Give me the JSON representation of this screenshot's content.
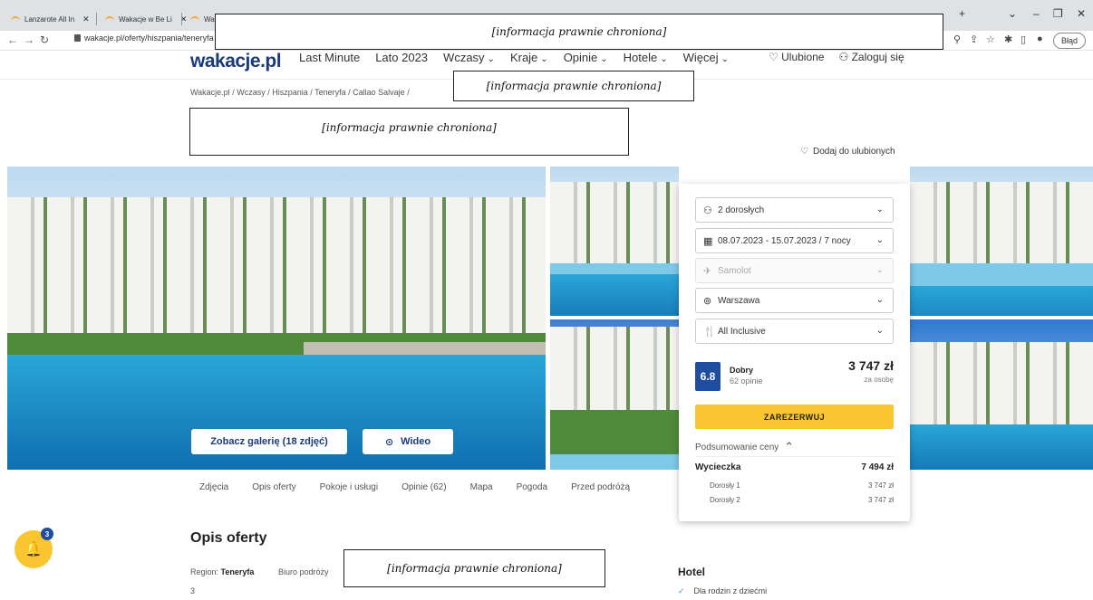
{
  "browser": {
    "tabs": [
      {
        "title": "Lanzarote All In"
      },
      {
        "title": "Wakacje w Be Li"
      },
      {
        "title": "Wak"
      }
    ],
    "url": "wakacje.pl/oferty/hiszpania/teneryfa",
    "error_badge": "Błąd",
    "new_tab": "+"
  },
  "redacted_text": "[informacja prawnie chroniona]",
  "site": {
    "logo": "wakacje.pl",
    "nav": [
      "Last Minute",
      "Lato 2023",
      "Wczasy",
      "Kraje",
      "Opinie",
      "Hotele",
      "Więcej"
    ],
    "favorites": "Ulubione",
    "login": "Zaloguj się"
  },
  "breadcrumb": [
    "Wakacje.pl",
    "Wczasy",
    "Hiszpania",
    "Teneryfa",
    "Callao Salvaje"
  ],
  "add_favorite": "Dodaj do ulubionych",
  "gallery": {
    "see_gallery": "Zobacz galerię (18 zdjęć)",
    "video": "Wideo"
  },
  "booking": {
    "travelers": "2 dorosłych",
    "dates": "08.07.2023 - 15.07.2023 / 7 nocy",
    "transport": "Samolot",
    "departure": "Warszawa",
    "board": "All Inclusive",
    "score": "6.8",
    "rating_word": "Dobry",
    "rating_count": "62 opinie",
    "price": "3 747 zł",
    "price_per": "za osobę",
    "book_label": "ZAREZERWUJ",
    "summary_title": "Podsumowanie ceny",
    "trip_label": "Wycieczka",
    "trip_total": "7 494 zł",
    "lines": [
      {
        "label": "Dorosły 1",
        "amount": "3 747 zł"
      },
      {
        "label": "Dorosły 2",
        "amount": "3 747 zł"
      }
    ]
  },
  "section_tabs": [
    "Zdjęcia",
    "Opis oferty",
    "Pokoje i usługi",
    "Opinie (62)",
    "Mapa",
    "Pogoda",
    "Przed podróżą"
  ],
  "notifications": {
    "count": "3"
  },
  "offer": {
    "heading": "Opis oferty",
    "region_label": "Region:",
    "region_value": "Teneryfa",
    "agency_label": "Biuro podróży",
    "stars": "3"
  },
  "hotel": {
    "heading": "Hotel",
    "features": [
      "Dla rodzin z dziećmi"
    ]
  },
  "colors": {
    "brand_blue": "#1a3a78",
    "score_blue": "#1f4ea1",
    "cta_yellow": "#f9c631"
  }
}
